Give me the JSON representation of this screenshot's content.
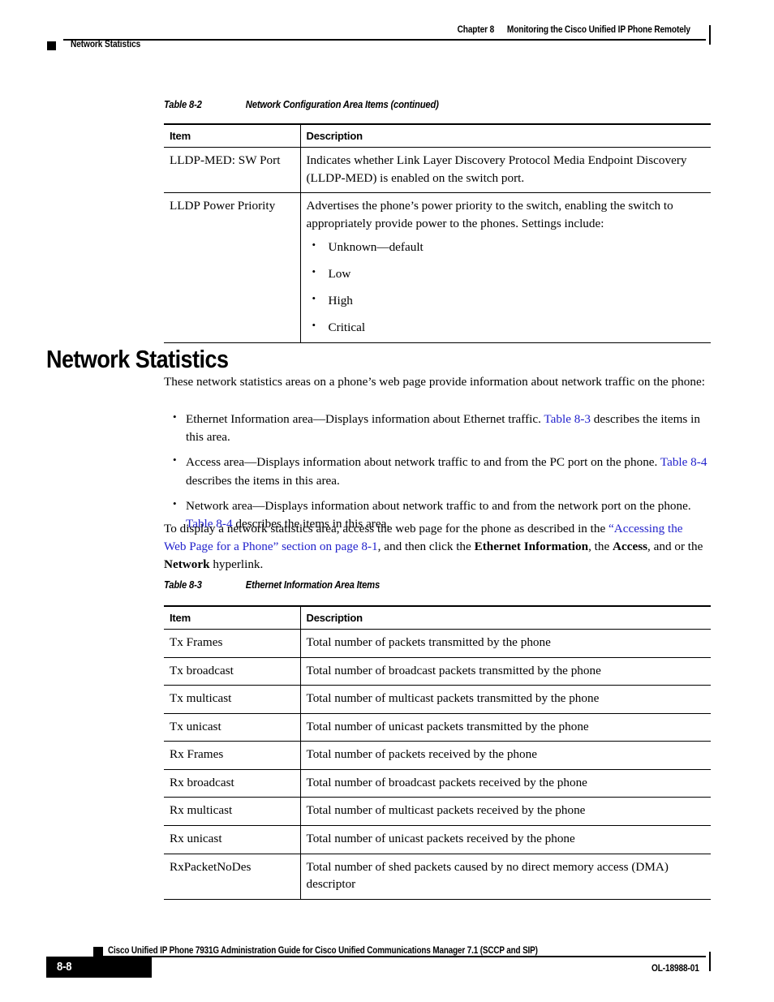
{
  "header": {
    "chapter_label": "Chapter 8",
    "chapter_title": "Monitoring the Cisco Unified IP Phone Remotely",
    "section_title": "Network Statistics"
  },
  "table_8_2": {
    "caption_number": "Table 8-2",
    "caption_title": "Network Configuration Area Items (continued)",
    "columns": [
      "Item",
      "Description"
    ],
    "rows": [
      {
        "item": "LLDP-MED: SW Port",
        "description": "Indicates whether Link Layer Discovery Protocol Media Endpoint Discovery (LLDP-MED) is enabled on the switch port.",
        "bullets": []
      },
      {
        "item": "LLDP Power Priority",
        "description": "Advertises the phone’s power priority to the switch, enabling the switch to appropriately provide power to the phones. Settings include:",
        "bullets": [
          "Unknown—default",
          "Low",
          "High",
          "Critical"
        ]
      }
    ]
  },
  "section": {
    "heading": "Network Statistics",
    "intro": "These network statistics areas on a phone’s web page provide information about network traffic on the phone:",
    "bullets": [
      {
        "pre": "Ethernet Information area—Displays information about Ethernet traffic. ",
        "link": "Table 8-3",
        "post": " describes the items in this area."
      },
      {
        "pre": "Access area—Displays information about network traffic to and from the PC port on the phone. ",
        "link": "Table 8-4",
        "post": " describes the items in this area."
      },
      {
        "pre": "Network area—Displays information about network traffic to and from the network port on the phone. ",
        "link": "Table 8-4",
        "post": " describes the items in this area."
      }
    ],
    "closing": {
      "part1": "To display a network statistics area, access the web page for the phone as described in the ",
      "link": "“Accessing the Web Page for a Phone” section on page 8-1",
      "part2": ", and then click the ",
      "bold1": "Ethernet Information",
      "part3": ", the ",
      "bold2": "Access",
      "part4": ", and or the ",
      "bold3": "Network",
      "part5": " hyperlink."
    }
  },
  "table_8_3": {
    "caption_number": "Table 8-3",
    "caption_title": "Ethernet Information Area Items",
    "columns": [
      "Item",
      "Description"
    ],
    "rows": [
      {
        "item": "Tx Frames",
        "description": "Total number of packets transmitted by the phone"
      },
      {
        "item": "Tx broadcast",
        "description": "Total number of broadcast packets transmitted by the phone"
      },
      {
        "item": "Tx multicast",
        "description": "Total number of multicast packets transmitted by the phone"
      },
      {
        "item": "Tx unicast",
        "description": "Total number of unicast packets transmitted by the phone"
      },
      {
        "item": "Rx Frames",
        "description": "Total number of packets received by the phone"
      },
      {
        "item": "Rx broadcast",
        "description": "Total number of broadcast packets received by the phone"
      },
      {
        "item": "Rx multicast",
        "description": "Total number of multicast packets received by the phone"
      },
      {
        "item": "Rx unicast",
        "description": "Total number of unicast packets received by the phone"
      },
      {
        "item": "RxPacketNoDes",
        "description": "Total number of shed packets caused by no direct memory access (DMA) descriptor"
      }
    ]
  },
  "footer": {
    "guide_title": "Cisco Unified IP Phone 7931G Administration Guide for Cisco Unified Communications Manager 7.1 (SCCP and SIP)",
    "page_number": "8-8",
    "doc_id": "OL-18988-01"
  },
  "colors": {
    "link": "#2222cc",
    "text": "#000000",
    "background": "#ffffff"
  }
}
